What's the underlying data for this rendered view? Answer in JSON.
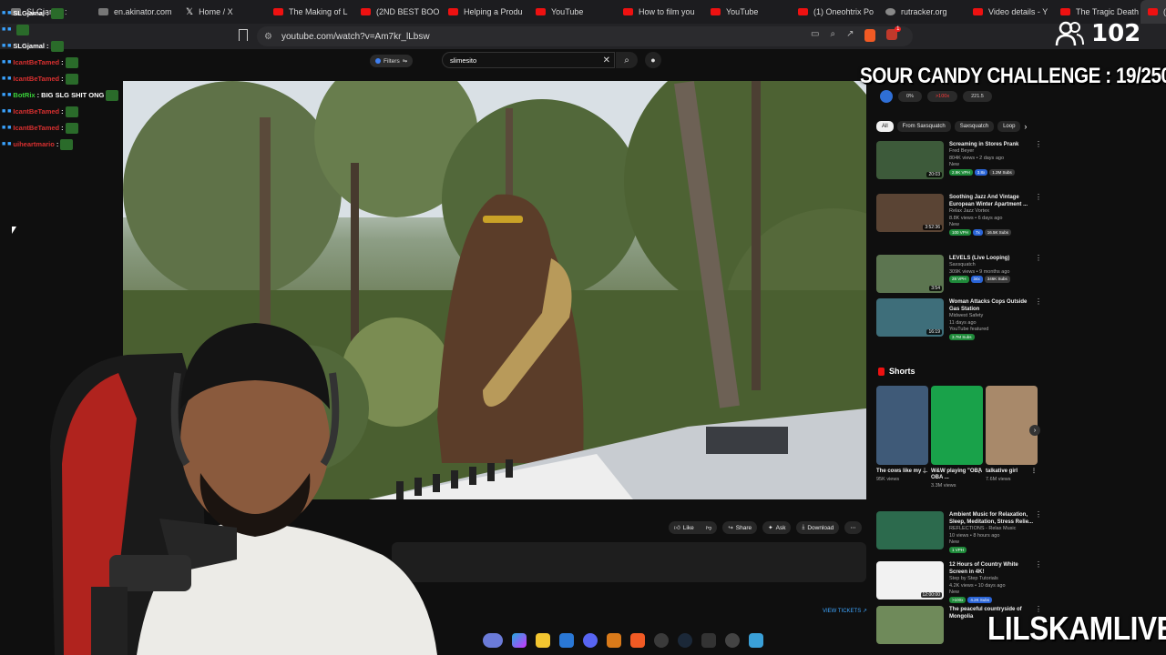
{
  "tabs": [
    {
      "label": "SLGjamal :",
      "icon": "avatar-icon",
      "active": false
    },
    {
      "label": "en.akinator.com",
      "icon": "akinator-icon",
      "active": false
    },
    {
      "label": "Home / X",
      "icon": "x-logo-icon",
      "active": false
    },
    {
      "label": "The Making of L",
      "icon": "youtube-icon",
      "active": false
    },
    {
      "label": "(2ND BEST BOO",
      "icon": "youtube-icon",
      "active": false
    },
    {
      "label": "Helping a Produ",
      "icon": "youtube-icon",
      "active": false
    },
    {
      "label": "YouTube",
      "icon": "youtube-icon",
      "active": false
    },
    {
      "label": "How to film you",
      "icon": "youtube-icon",
      "active": false
    },
    {
      "label": "YouTube",
      "icon": "youtube-icon",
      "active": false
    },
    {
      "label": "(1) Oneohtrix Po",
      "icon": "youtube-icon",
      "active": false
    },
    {
      "label": "rutracker.org",
      "icon": "gear-icon",
      "active": false
    },
    {
      "label": "Video details - Y",
      "icon": "youtube-icon",
      "active": false
    },
    {
      "label": "The Tragic Death",
      "icon": "youtube-icon",
      "active": false
    },
    {
      "label": "(1) Bette",
      "icon": "youtube-icon",
      "active": true
    }
  ],
  "address": {
    "url": "youtube.com/watch?v=Am7kr_lLbsw"
  },
  "viewer_count": "102",
  "chat": [
    {
      "user": "SLGjamal",
      "color": "#ffffff",
      "text": ":"
    },
    {
      "user": "",
      "color": "#d93030",
      "text": ""
    },
    {
      "user": "SLGjamal",
      "color": "#ffffff",
      "text": ":"
    },
    {
      "user": "IcantBeTamed",
      "color": "#d93030",
      "text": ":"
    },
    {
      "user": "IcantBeTamed",
      "color": "#d93030",
      "text": ":"
    },
    {
      "user": "BotRix",
      "color": "#3ad13a",
      "text": ": BIG SLG SHIT ONG"
    },
    {
      "user": "IcantBeTamed",
      "color": "#d93030",
      "text": ":"
    },
    {
      "user": "IcantBeTamed",
      "color": "#d93030",
      "text": ":"
    },
    {
      "user": "uiheartmario",
      "color": "#d93030",
      "text": ":"
    }
  ],
  "yt": {
    "filters_label": "Filters",
    "search_value": "slimesito",
    "actions": {
      "like": "Like",
      "share": "Share",
      "ask": "Ask",
      "download": "Download"
    },
    "view_tickets": "VIEW TICKETS"
  },
  "overlay": {
    "challenge": "SOUR CANDY CHALLENGE : 19/250",
    "brand": "LILSKAMLIVE"
  },
  "extension_bar": {
    "a": "0%",
    "b": ">100x",
    "c": "221.5"
  },
  "chips": [
    "All",
    "From Saxsquatch",
    "Saxsquatch",
    "Loop"
  ],
  "recommendations": [
    {
      "title": "Screaming in Stores Prank",
      "channel": "Fred Beyer",
      "meta": "804K views • 2 days ago",
      "badge": "New",
      "duration": "20:03",
      "thumb": "#3d5a3a",
      "tags": [
        "2.9K VPH",
        "3.8x",
        "1.2M Subs"
      ]
    },
    {
      "title": "Soothing Jazz And Vintage European Winter Apartment ...",
      "channel": "Relax Jazz Vortex",
      "meta": "8.8K views • 6 days ago",
      "badge": "New",
      "duration": "3:52:36",
      "thumb": "#5a4434",
      "tags": [
        "100 VPH",
        "7x",
        "16.5K Subs"
      ]
    },
    {
      "title": "LEVELS (Live Looping)",
      "channel": "Saxsquatch",
      "meta": "309K views • 9 months ago",
      "badge": "",
      "duration": "3:54",
      "thumb": "#5c7550",
      "tags": [
        "28 VPH",
        "34x",
        "346K Subs"
      ]
    },
    {
      "title": "Woman Attacks Cops Outside Gas Station",
      "channel": "Midwest Safety",
      "meta": "11 days ago",
      "badge": "YouTube featured",
      "duration": "16:19",
      "thumb": "#3e6e7a",
      "tags": [
        "3.7M Subs"
      ]
    },
    {
      "title": "Ambient Music for Relaxation, Sleep, Meditation, Stress Relie...",
      "channel": "REFLECTIONS - Relax Music",
      "meta": "10 views • 8 hours ago",
      "badge": "New",
      "duration": "",
      "thumb": "#2c6a4d",
      "tags": [
        "1 VPH"
      ]
    },
    {
      "title": "12 Hours of Country White Screen in 4K!",
      "channel": "Step by Step Tutorials",
      "meta": "4.2K views • 10 days ago",
      "badge": "New",
      "duration": "12:00:00",
      "thumb": "#f2f2f2",
      "tags": [
        ">100x",
        "4.2K Subs"
      ]
    },
    {
      "title": "The peaceful countryside of Mongolia",
      "channel": "",
      "meta": "",
      "badge": "",
      "duration": "",
      "thumb": "#6f8a5a",
      "tags": []
    }
  ],
  "shorts": {
    "title": "Shorts",
    "items": [
      {
        "title": "The cows like my ...",
        "views": "95K views",
        "thumb": "#3f5a78"
      },
      {
        "title": "W&W playing \"OBA OBA ...",
        "views": "3.3M views",
        "thumb": "#19a24a"
      },
      {
        "title": "talkative girl",
        "views": "7.6M views",
        "thumb": "#a8896a"
      }
    ]
  },
  "colors": {
    "youtube_red": "#ff0000",
    "link_blue": "#3ea6ff",
    "ext_red": "#ff3b3b"
  }
}
